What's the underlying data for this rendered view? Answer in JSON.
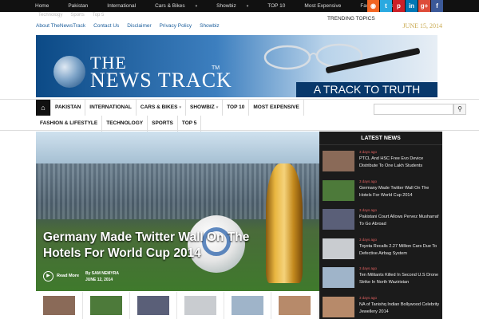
{
  "topbar": {
    "nav": [
      {
        "label": "Home",
        "caret": false
      },
      {
        "label": "Pakistan",
        "caret": false
      },
      {
        "label": "International",
        "caret": false
      },
      {
        "label": "Cars & Bikes",
        "caret": true
      },
      {
        "label": "Showbiz",
        "caret": true
      },
      {
        "label": "TOP 10",
        "caret": false
      },
      {
        "label": "Most Expensive",
        "caret": false
      },
      {
        "label": "Fashion & LifeStyle",
        "caret": false
      }
    ],
    "caret_glyph": "▾",
    "subnav_ghost": [
      "Technology",
      "Sports",
      "Top 5"
    ],
    "social": [
      {
        "name": "rss-icon",
        "glyph": "◉",
        "color": "#f26522"
      },
      {
        "name": "twitter-icon",
        "glyph": "t",
        "color": "#2aa9e0"
      },
      {
        "name": "pinterest-icon",
        "glyph": "p",
        "color": "#cb2027"
      },
      {
        "name": "linkedin-icon",
        "glyph": "in",
        "color": "#0077b5"
      },
      {
        "name": "googleplus-icon",
        "glyph": "g+",
        "color": "#dd4b39"
      },
      {
        "name": "facebook-icon",
        "glyph": "f",
        "color": "#3b5998"
      }
    ]
  },
  "links": [
    "About TheNewsTrack",
    "Contact Us",
    "Disclaimer",
    "Privacy Policy",
    "Showbiz"
  ],
  "trending_label": "TRENDING TOPICS",
  "date": "JUNE 15, 2014",
  "banner": {
    "title_line1": "THE",
    "title_line2": "NEWS TRACK",
    "tm": "TM",
    "slogan": "A TRACK TO TRUTH"
  },
  "mainnav": {
    "row1": [
      {
        "label": "PAKISTAN",
        "caret": false
      },
      {
        "label": "INTERNATIONAL",
        "caret": false
      },
      {
        "label": "CARS & BIKES",
        "caret": true
      },
      {
        "label": "SHOWBIZ",
        "caret": true
      },
      {
        "label": "TOP 10",
        "caret": false
      },
      {
        "label": "MOST EXPENSIVE",
        "caret": false
      }
    ],
    "row2": [
      {
        "label": "FASHION & LIFESTYLE",
        "caret": false
      },
      {
        "label": "TECHNOLOGY",
        "caret": false
      },
      {
        "label": "SPORTS",
        "caret": false
      },
      {
        "label": "TOP 5",
        "caret": false
      }
    ],
    "home_glyph": "⌂",
    "search_glyph": "⚲",
    "caret_glyph": "▾"
  },
  "hero": {
    "title": "Germany Made Twitter Wall On The Hotels For World Cup 2014",
    "read_more": "Read More",
    "by": "By",
    "author": "SAM NEMYRA",
    "date": "JUNE 12, 2014",
    "play_glyph": "▶"
  },
  "latest": {
    "heading": "LATEST NEWS",
    "items": [
      {
        "ago": "3 days ago",
        "title": "PTCL And HSC Free Evo Device Distribute To One Lakh Students",
        "thumb": "#8a6a58"
      },
      {
        "ago": "3 days ago",
        "title": "Germany Made Twitter Wall On The Hotels For World Cup 2014",
        "thumb": "#4d7a3a"
      },
      {
        "ago": "3 days ago",
        "title": "Pakistani Court Allows Pervez Musharraf To Go Abroad",
        "thumb": "#5a5f78"
      },
      {
        "ago": "3 days ago",
        "title": "Toyota Recalls 2.27 Million Cars Due To Defective Airbag System",
        "thumb": "#c9ccd0"
      },
      {
        "ago": "3 days ago",
        "title": "Ten Militants Killed In Second U.S Drone Strike In North Waziristan",
        "thumb": "#9fb4c9"
      },
      {
        "ago": "3 days ago",
        "title": "NA of Tanishq Indian Bollywood Celebrity Jewellery 2014",
        "thumb": "#b78a6a"
      }
    ]
  },
  "strip": {
    "thumbs": [
      "#8a6a58",
      "#4d7a3a",
      "#5a5f78",
      "#c9ccd0",
      "#9fb4c9",
      "#b78a6a"
    ]
  }
}
